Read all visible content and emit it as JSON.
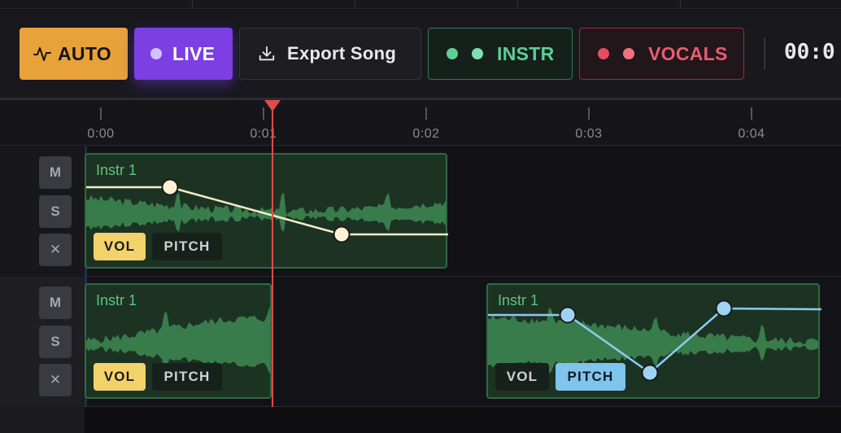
{
  "toolbar": {
    "auto_label": "AUTO",
    "live_label": "LIVE",
    "export_label": "Export Song",
    "instr_label": "INSTR",
    "vocals_label": "VOCALS",
    "timecode": "00:0"
  },
  "ruler": {
    "labels": [
      "0:00",
      "0:01",
      "0:02",
      "0:03",
      "0:04"
    ]
  },
  "tracks": [
    {
      "buttons": {
        "mute": "M",
        "solo": "S",
        "remove": "✕"
      },
      "clips": [
        {
          "name": "Instr 1",
          "tags": {
            "vol": "VOL",
            "pitch": "PITCH"
          },
          "active_lane": "vol"
        }
      ]
    },
    {
      "buttons": {
        "mute": "M",
        "solo": "S",
        "remove": "✕"
      },
      "clips": [
        {
          "name": "Instr 1",
          "tags": {
            "vol": "VOL",
            "pitch": "PITCH"
          },
          "active_lane": "vol"
        },
        {
          "name": "Instr 1",
          "tags": {
            "vol": "VOL",
            "pitch": "PITCH"
          },
          "active_lane": "pitch"
        }
      ]
    }
  ],
  "colors": {
    "auto": "#e8a23a",
    "live": "#7b3fe4",
    "instr": "#5ccf95",
    "vocals": "#ec5b70",
    "vol_curve": "#f7ecc6",
    "pitch_curve": "#8ccaf0",
    "playhead": "#e24b4b"
  },
  "icons": {
    "auto": "activity-pulse-icon",
    "export": "download-icon"
  }
}
